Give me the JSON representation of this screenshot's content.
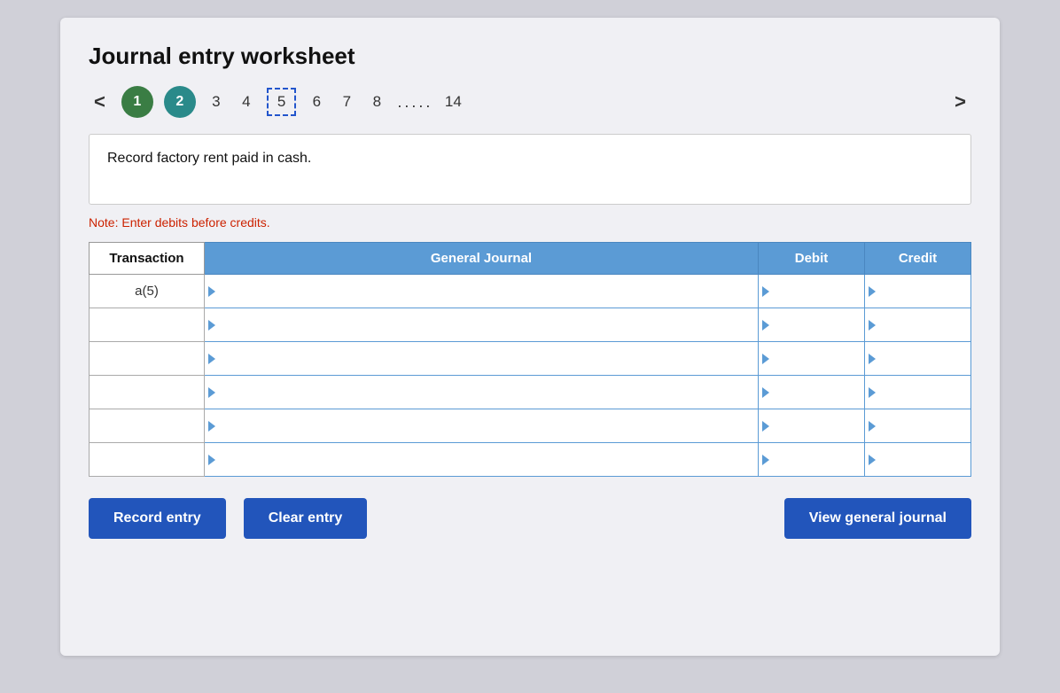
{
  "title": "Journal entry worksheet",
  "nav": {
    "prev_label": "<",
    "next_label": ">",
    "items": [
      {
        "label": "1",
        "type": "circle-green"
      },
      {
        "label": "2",
        "type": "circle-teal"
      },
      {
        "label": "3",
        "type": "number"
      },
      {
        "label": "4",
        "type": "number"
      },
      {
        "label": "5",
        "type": "selected"
      },
      {
        "label": "6",
        "type": "number"
      },
      {
        "label": "7",
        "type": "number"
      },
      {
        "label": "8",
        "type": "number"
      },
      {
        "label": ".....",
        "type": "dots"
      },
      {
        "label": "14",
        "type": "number"
      }
    ]
  },
  "instruction": "Record factory rent paid in cash.",
  "note": "Note: Enter debits before credits.",
  "table": {
    "headers": [
      "Transaction",
      "General Journal",
      "Debit",
      "Credit"
    ],
    "rows": [
      {
        "transaction": "a(5)",
        "journal": "",
        "debit": "",
        "credit": ""
      },
      {
        "transaction": "",
        "journal": "",
        "debit": "",
        "credit": ""
      },
      {
        "transaction": "",
        "journal": "",
        "debit": "",
        "credit": ""
      },
      {
        "transaction": "",
        "journal": "",
        "debit": "",
        "credit": ""
      },
      {
        "transaction": "",
        "journal": "",
        "debit": "",
        "credit": ""
      },
      {
        "transaction": "",
        "journal": "",
        "debit": "",
        "credit": ""
      }
    ]
  },
  "buttons": {
    "record_entry": "Record entry",
    "clear_entry": "Clear entry",
    "view_general_journal": "View general journal"
  }
}
